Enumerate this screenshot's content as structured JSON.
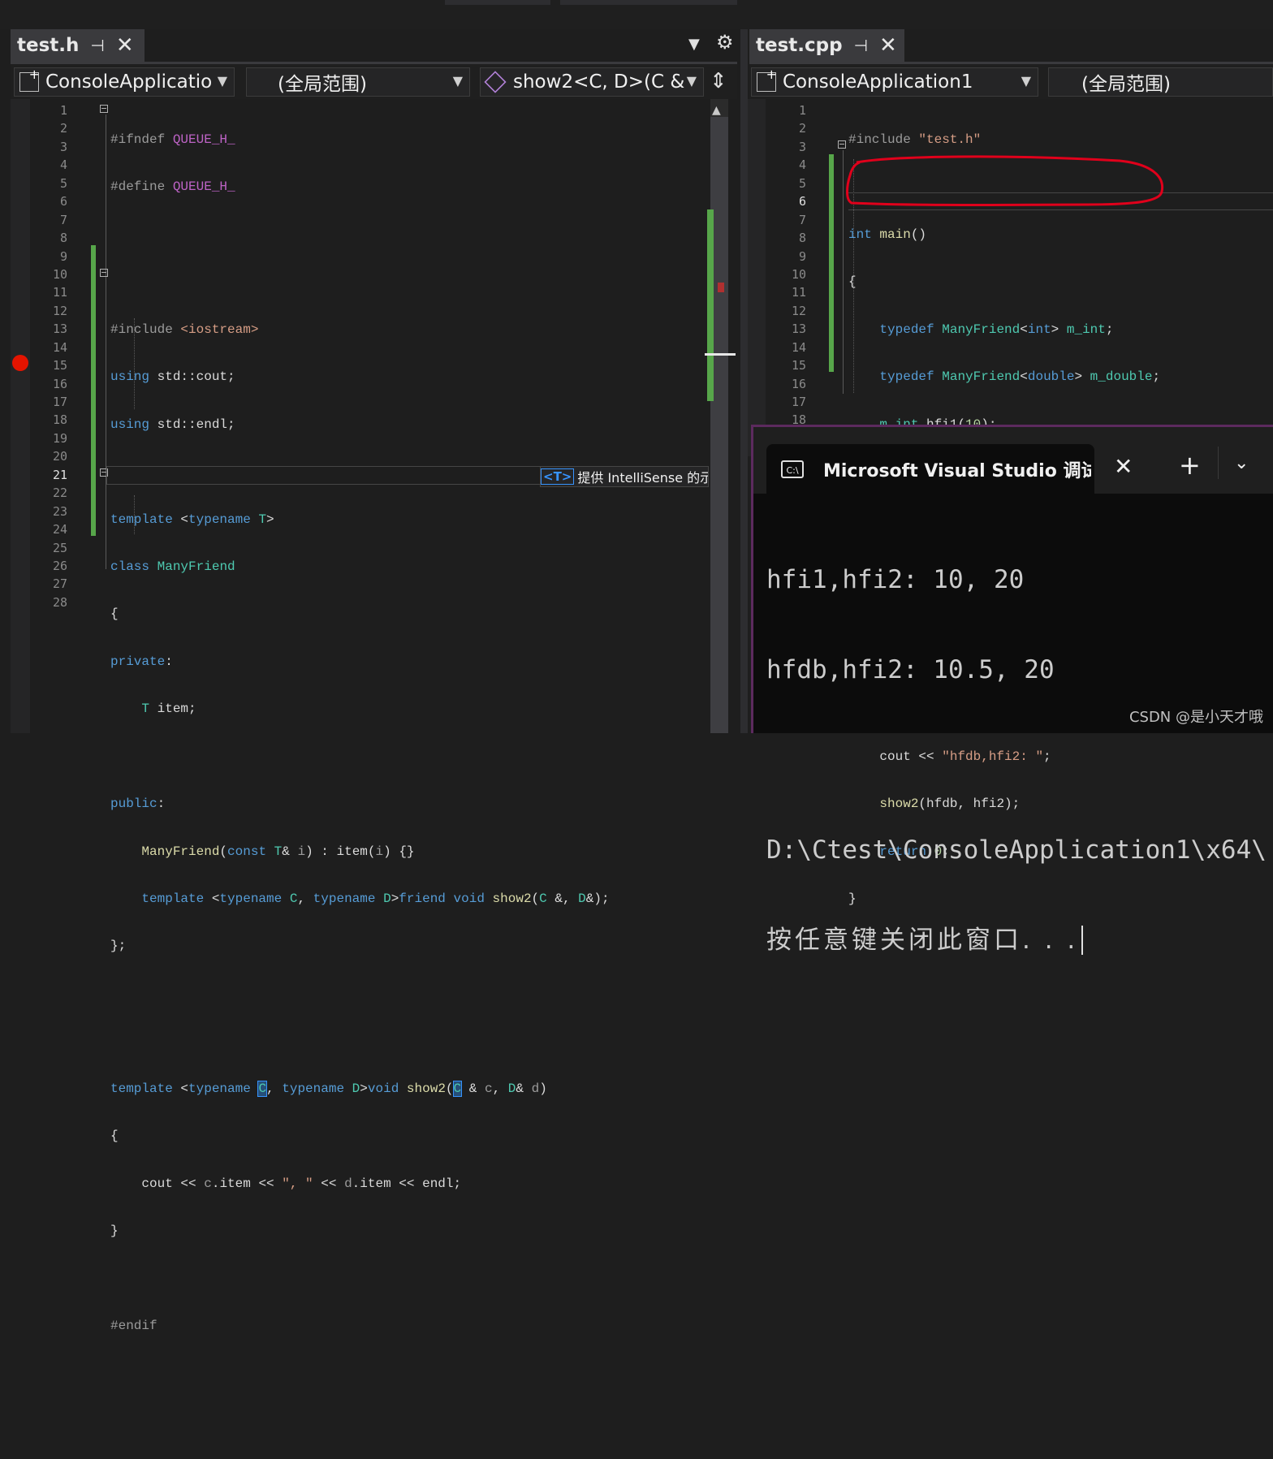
{
  "left": {
    "tab": {
      "title": "test.h"
    },
    "nav": {
      "project": "ConsoleApplicatio",
      "scope": "(全局范围)",
      "member": "show2<C, D>(C &"
    },
    "line_numbers": [
      "1",
      "2",
      "3",
      "4",
      "5",
      "6",
      "7",
      "8",
      "9",
      "10",
      "11",
      "12",
      "13",
      "14",
      "15",
      "16",
      "17",
      "18",
      "19",
      "20",
      "21",
      "22",
      "23",
      "24",
      "25",
      "26",
      "27",
      "28"
    ],
    "current_line": "21",
    "tooltip": {
      "badge": "<T>",
      "text": "提供 IntelliSense 的示"
    }
  },
  "right": {
    "tab": {
      "title": "test.cpp"
    },
    "nav": {
      "project": "ConsoleApplication1",
      "scope": "(全局范围)"
    },
    "line_numbers": [
      "1",
      "2",
      "3",
      "4",
      "5",
      "6",
      "7",
      "8",
      "9",
      "10",
      "11",
      "12",
      "13",
      "14",
      "15",
      "16",
      "17",
      "18"
    ],
    "current_line": "6"
  },
  "terminal": {
    "tab_title": "Microsoft Visual Studio 调试控",
    "icon_label": "C:\\",
    "output": [
      "hfi1,hfi2: 10, 20",
      "hfdb,hfi2: 10.5, 20",
      "",
      "D:\\Ctest\\ConsoleApplication1\\x64\\",
      "按任意键关闭此窗口. . ."
    ]
  },
  "watermark": "CSDN @是小天才哦",
  "colors": {
    "background": "#1e1e1e",
    "keyword": "#569cd6",
    "type": "#4ec9b0",
    "function": "#dcdcaa",
    "string": "#d69d85",
    "change_bar": "#57a64a",
    "annotation": "#e0001b"
  }
}
